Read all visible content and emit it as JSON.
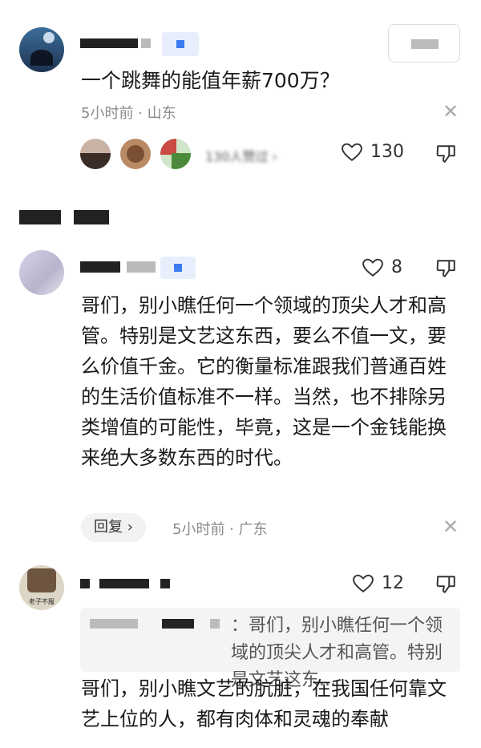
{
  "comment1": {
    "text": "一个跳舞的能值年薪700万？",
    "meta": "5小时前 · 山东",
    "like_count": "130",
    "reactors_text": "130人赞过 ›"
  },
  "comment2": {
    "text": "哥们，别小瞧任何一个领域的顶尖人才和高管。特别是文艺这东西，要么不值一文，要么价值千金。它的衡量标准跟我们普通百姓的生活价值标准不一样。当然，也不排除另类增值的可能性，毕竟，这是一个金钱能换来绝大多数东西的时代。",
    "like_count": "8",
    "reply_label": "回复 ›",
    "meta": "5小时前 · 广东"
  },
  "comment3": {
    "avatar_text": "老子不服",
    "like_count": "12",
    "quote": "：哥们，别小瞧任何一个领域的顶尖人才和高管。特别是文艺这东...",
    "text": "哥们，别小瞧文艺的肮脏，在我国任何靠文艺上位的人，都有肉体和灵魂的奉献"
  },
  "colors": {
    "accent": "#3b7df0",
    "meta": "#8a8a8a",
    "quote_bg": "#f4f4f4"
  },
  "icons": [
    "heart-icon",
    "dislike-icon",
    "close-icon"
  ]
}
